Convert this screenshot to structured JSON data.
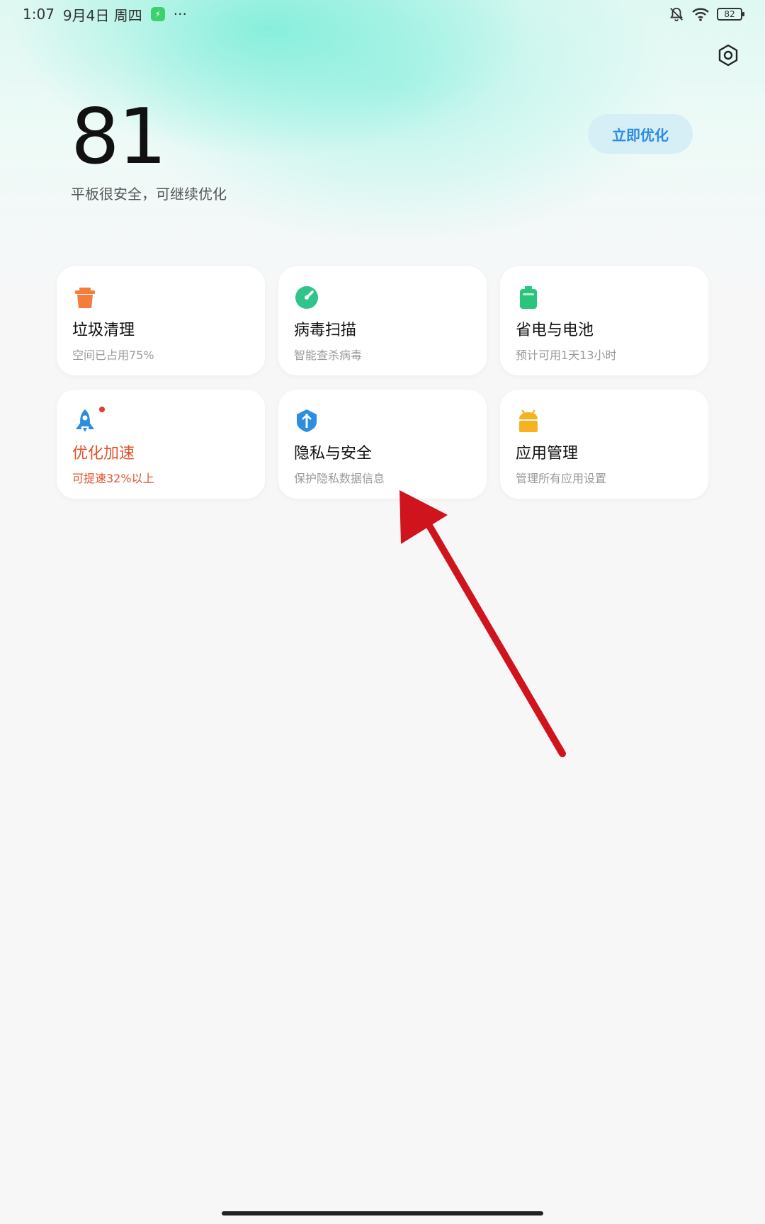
{
  "status_bar": {
    "time": "1:07",
    "date": "9月4日 周四",
    "more": "···",
    "battery": "82"
  },
  "hero": {
    "score": "81",
    "description": "平板很安全，可继续优化",
    "optimize_button": "立即优化"
  },
  "cards": [
    {
      "title": "垃圾清理",
      "subtitle": "空间已占用75%",
      "icon": "trash-icon",
      "color": "#f47c3c"
    },
    {
      "title": "病毒扫描",
      "subtitle": "智能查杀病毒",
      "icon": "scan-icon",
      "color": "#2ec48a"
    },
    {
      "title": "省电与电池",
      "subtitle": "预计可用1天13小时",
      "icon": "battery-icon",
      "color": "#2bc47d"
    },
    {
      "title": "优化加速",
      "subtitle": "可提速32%以上",
      "icon": "rocket-icon",
      "color": "#2d8de0"
    },
    {
      "title": "隐私与安全",
      "subtitle": "保护隐私数据信息",
      "icon": "shield-icon",
      "color": "#2d8de0"
    },
    {
      "title": "应用管理",
      "subtitle": "管理所有应用设置",
      "icon": "android-icon",
      "color": "#f7b21e"
    }
  ],
  "colors": {
    "accent_blue": "#2d8de0",
    "alert_orange": "#e0542c",
    "annotation_arrow": "#d0141e"
  }
}
